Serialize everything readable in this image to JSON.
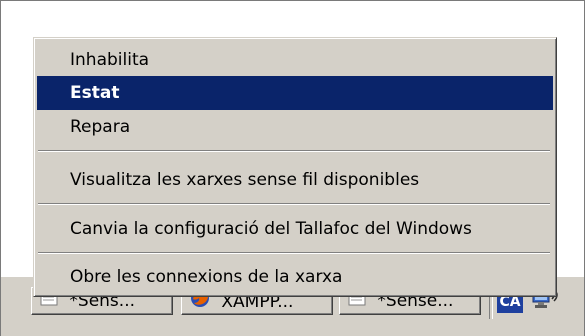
{
  "menu": {
    "items": [
      {
        "label": "Inhabilita"
      },
      {
        "label": "Estat"
      },
      {
        "label": "Repara"
      },
      {
        "label": "Visualitza les xarxes sense fil disponibles"
      },
      {
        "label": "Canvia la configuració del Tallafoc del Windows"
      },
      {
        "label": "Obre les connexions de la xarxa"
      }
    ],
    "selected_index": 1
  },
  "taskbar": {
    "buttons": [
      {
        "label": "*Sens...",
        "icon": "notepad-icon"
      },
      {
        "label": "XAMPP...",
        "icon": "firefox-icon"
      },
      {
        "label": "*Sense...",
        "icon": "notepad-icon"
      }
    ],
    "language_indicator": "CA",
    "tray_icon": "network-connection-icon"
  },
  "colors": {
    "menu_background": "#d4d0c8",
    "selection_background": "#0a246a",
    "selection_text": "#ffffff",
    "language_badge": "#1e3f9e"
  }
}
